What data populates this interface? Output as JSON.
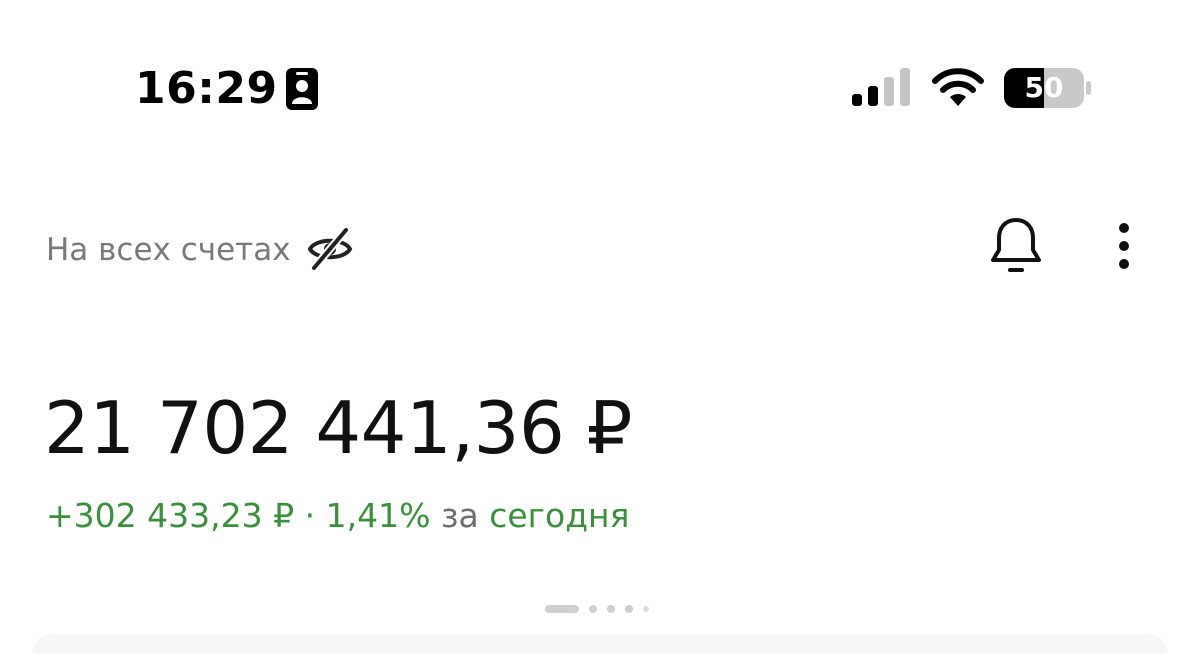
{
  "status_bar": {
    "time": "16:29",
    "battery_level": "50",
    "icons": [
      "focus-person-icon",
      "cellular-signal-icon",
      "wifi-icon",
      "battery-icon"
    ]
  },
  "header": {
    "title": "На всех счетах",
    "icons": [
      "eye-off-icon",
      "bell-icon",
      "more-vertical-icon"
    ]
  },
  "balance": {
    "amount": "21 702 441,36 ₽",
    "change_amount": "+302 433,23 ₽",
    "separator": "·",
    "change_percent": "1,41%",
    "period_prefix": "за",
    "period": "сегодня"
  },
  "pager": {
    "pages": 5,
    "active_index": 0
  },
  "colors": {
    "positive": "#3b8f3d",
    "secondary_text": "#7a7a7a",
    "primary_text": "#111111"
  }
}
